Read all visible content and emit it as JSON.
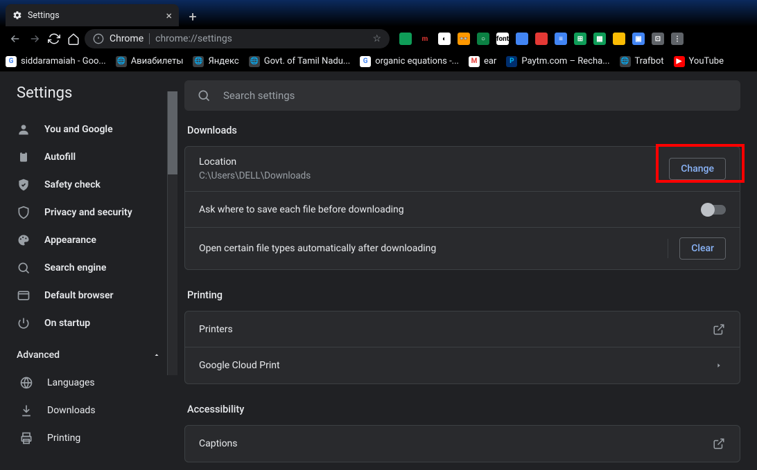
{
  "window": {
    "tab_title": "Settings",
    "url_prefix": "Chrome",
    "url_path": "chrome://settings"
  },
  "extensions": [
    {
      "bg": "#0f9d58",
      "txt": ""
    },
    {
      "bg": "#000",
      "txt": "m",
      "fg": "#e53935"
    },
    {
      "bg": "#fff",
      "txt": "◐",
      "fg": "#000"
    },
    {
      "bg": "#ff9800",
      "txt": "👓"
    },
    {
      "bg": "#0b8043",
      "txt": "○"
    },
    {
      "bg": "#fff",
      "txt": "font",
      "fg": "#000"
    },
    {
      "bg": "#4285f4",
      "txt": ""
    },
    {
      "bg": "#e53935",
      "txt": ""
    },
    {
      "bg": "#4285f4",
      "txt": "≡"
    },
    {
      "bg": "#0f9d58",
      "txt": "⊞"
    },
    {
      "bg": "#0f9d58",
      "txt": "▦"
    },
    {
      "bg": "#fbbc04",
      "txt": ""
    },
    {
      "bg": "#4285f4",
      "txt": "▣"
    },
    {
      "bg": "#5f6368",
      "txt": "⊡"
    },
    {
      "bg": "#5f6368",
      "txt": "⋮"
    }
  ],
  "bookmarks": [
    {
      "label": "siddaramaiah - Goo...",
      "favbg": "#fff",
      "favtxt": "G",
      "favfg": "#4285f4"
    },
    {
      "label": "Авиабилеты",
      "favbg": "#3c4043",
      "favtxt": "🌐",
      "favfg": "#fff"
    },
    {
      "label": "Яндекс",
      "favbg": "#3c4043",
      "favtxt": "🌐",
      "favfg": "#fff"
    },
    {
      "label": "Govt. of Tamil Nadu...",
      "favbg": "#3c4043",
      "favtxt": "🌐",
      "favfg": "#fff"
    },
    {
      "label": "organic equations -...",
      "favbg": "#fff",
      "favtxt": "G",
      "favfg": "#4285f4"
    },
    {
      "label": "ear",
      "favbg": "#fff",
      "favtxt": "M",
      "favfg": "#e53935"
    },
    {
      "label": "Paytm.com – Recha...",
      "favbg": "#002e6e",
      "favtxt": "P",
      "favfg": "#00baf2"
    },
    {
      "label": "Trafbot",
      "favbg": "#3c4043",
      "favtxt": "🌐",
      "favfg": "#fff"
    },
    {
      "label": "YouTube",
      "favbg": "#ff0000",
      "favtxt": "▶",
      "favfg": "#fff"
    }
  ],
  "sidebar": {
    "title": "Settings",
    "items": [
      {
        "label": "You and Google",
        "icon": "person"
      },
      {
        "label": "Autofill",
        "icon": "clipboard"
      },
      {
        "label": "Safety check",
        "icon": "shield-check"
      },
      {
        "label": "Privacy and security",
        "icon": "shield"
      },
      {
        "label": "Appearance",
        "icon": "palette"
      },
      {
        "label": "Search engine",
        "icon": "search"
      },
      {
        "label": "Default browser",
        "icon": "browser"
      },
      {
        "label": "On startup",
        "icon": "power"
      }
    ],
    "advanced_label": "Advanced",
    "advanced_items": [
      {
        "label": "Languages",
        "icon": "globe"
      },
      {
        "label": "Downloads",
        "icon": "download"
      },
      {
        "label": "Printing",
        "icon": "print"
      }
    ]
  },
  "search_placeholder": "Search settings",
  "sections": {
    "downloads": {
      "title": "Downloads",
      "location_label": "Location",
      "location_value": "C:\\Users\\DELL\\Downloads",
      "change_btn": "Change",
      "ask_label": "Ask where to save each file before downloading",
      "open_label": "Open certain file types automatically after downloading",
      "clear_btn": "Clear"
    },
    "printing": {
      "title": "Printing",
      "printers_label": "Printers",
      "gcp_label": "Google Cloud Print"
    },
    "accessibility": {
      "title": "Accessibility",
      "captions_label": "Captions"
    }
  }
}
